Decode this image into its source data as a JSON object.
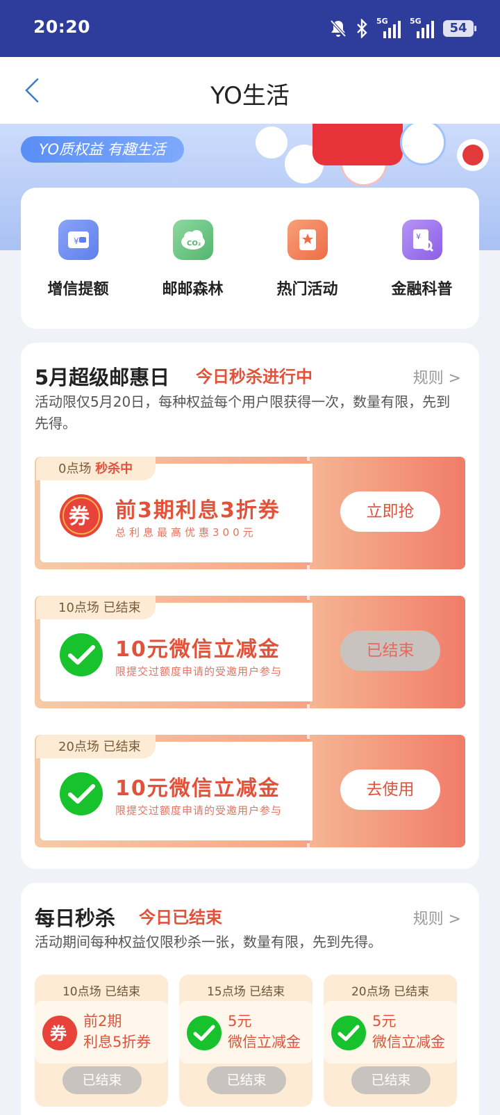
{
  "status_bar": {
    "time": "20:20",
    "battery": "54",
    "signal_label": "5G"
  },
  "nav": {
    "title": "YO生活"
  },
  "banner": {
    "slogan": "YO质权益 有趣生活"
  },
  "quick_menu": [
    {
      "label": "增信提额",
      "icon": "wallet-icon",
      "color": "#6e8ef2"
    },
    {
      "label": "邮邮森林",
      "icon": "co2-cloud-icon",
      "color": "#67c480"
    },
    {
      "label": "热门活动",
      "icon": "star-ticket-icon",
      "color": "#f27a52"
    },
    {
      "label": "金融科普",
      "icon": "finance-doc-icon",
      "color": "#9d6ee8"
    }
  ],
  "super_day": {
    "title": "5月超级邮惠日",
    "status": "今日秒杀进行中",
    "rules": "规则 >",
    "description": "活动限仅5月20日，每种权益每个用户限获得一次，数量有限，先到先得。",
    "coupons": [
      {
        "session": "0点场",
        "session_state": "秒杀中",
        "title": "前3期利息3折券",
        "subtitle": "总利息最高优惠300元",
        "button": "立即抢",
        "icon": "coupon-icon",
        "enabled": true
      },
      {
        "session": "10点场",
        "session_state": "已结束",
        "title": "10元微信立减金",
        "subtitle": "限提交过额度申请的受邀用户参与",
        "button": "已结束",
        "icon": "wechat-icon",
        "enabled": false
      },
      {
        "session": "20点场",
        "session_state": "已结束",
        "title": "10元微信立减金",
        "subtitle": "限提交过额度申请的受邀用户参与",
        "button": "去使用",
        "icon": "wechat-icon",
        "enabled": true
      }
    ]
  },
  "daily_flash": {
    "title": "每日秒杀",
    "status": "今日已结束",
    "rules": "规则 >",
    "description": "活动期间每种权益仅限秒杀一张，数量有限，先到先得。",
    "items": [
      {
        "session": "10点场 已结束",
        "line1": "前2期",
        "line2": "利息5折券",
        "button": "已结束",
        "icon": "coupon-icon"
      },
      {
        "session": "15点场 已结束",
        "line1": "5元",
        "line2": "微信立减金",
        "button": "已结束",
        "icon": "wechat-icon"
      },
      {
        "session": "20点场 已结束",
        "line1": "5元",
        "line2": "微信立减金",
        "button": "已结束",
        "icon": "wechat-icon"
      }
    ]
  }
}
